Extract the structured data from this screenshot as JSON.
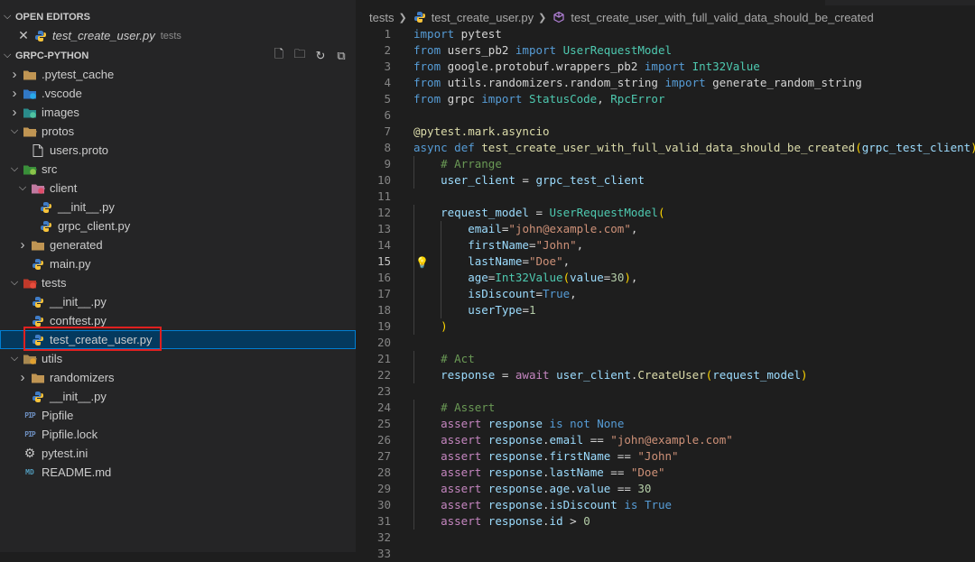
{
  "sidebar": {
    "open_editors_title": "OPEN EDITORS",
    "open_editor": {
      "name": "test_create_user.py",
      "folder": "tests"
    },
    "project_title": "GRPC-PYTHON",
    "tree": [
      {
        "label": ".pytest_cache",
        "icon": "folder-icon",
        "chevron": "closed",
        "level": 0
      },
      {
        "label": ".vscode",
        "icon": "vscode-folder-icon",
        "chevron": "closed",
        "level": 0
      },
      {
        "label": "images",
        "icon": "images-folder-icon",
        "chevron": "closed",
        "level": 0
      },
      {
        "label": "protos",
        "icon": "folder-open-icon",
        "chevron": "open",
        "level": 0
      },
      {
        "label": "users.proto",
        "icon": "file-icon",
        "chevron": "none",
        "level": 1
      },
      {
        "label": "src",
        "icon": "src-folder-icon",
        "chevron": "open",
        "level": 0
      },
      {
        "label": "client",
        "icon": "client-folder-icon",
        "chevron": "open",
        "level": 1
      },
      {
        "label": "__init__.py",
        "icon": "python-icon",
        "chevron": "none",
        "level": 2
      },
      {
        "label": "grpc_client.py",
        "icon": "python-icon",
        "chevron": "none",
        "level": 2
      },
      {
        "label": "generated",
        "icon": "folder-icon",
        "chevron": "closed",
        "level": 1
      },
      {
        "label": "main.py",
        "icon": "python-icon",
        "chevron": "none",
        "level": 1
      },
      {
        "label": "tests",
        "icon": "tests-folder-icon",
        "chevron": "open",
        "level": 0
      },
      {
        "label": "__init__.py",
        "icon": "python-icon",
        "chevron": "none",
        "level": 1
      },
      {
        "label": "conftest.py",
        "icon": "python-icon",
        "chevron": "none",
        "level": 1
      },
      {
        "label": "test_create_user.py",
        "icon": "python-icon",
        "chevron": "none",
        "level": 1,
        "selected": true
      },
      {
        "label": "utils",
        "icon": "utils-folder-icon",
        "chevron": "open",
        "level": 0
      },
      {
        "label": "randomizers",
        "icon": "folder-icon",
        "chevron": "closed",
        "level": 1
      },
      {
        "label": "__init__.py",
        "icon": "python-icon",
        "chevron": "none",
        "level": 1
      },
      {
        "label": "Pipfile",
        "icon": "pipfile-icon",
        "chevron": "none",
        "level": 0
      },
      {
        "label": "Pipfile.lock",
        "icon": "pipfile-icon",
        "chevron": "none",
        "level": 0
      },
      {
        "label": "pytest.ini",
        "icon": "gear-icon",
        "chevron": "none",
        "level": 0
      },
      {
        "label": "README.md",
        "icon": "readme-icon",
        "chevron": "none",
        "level": 0
      }
    ]
  },
  "breadcrumb": {
    "folder": "tests",
    "file": "test_create_user.py",
    "symbol": "test_create_user_with_full_valid_data_should_be_created"
  },
  "editor": {
    "active_line": 15,
    "lines": [
      {
        "n": "1",
        "text": "import pytest"
      },
      {
        "n": "2",
        "text": "from users_pb2 import UserRequestModel"
      },
      {
        "n": "3",
        "text": "from google.protobuf.wrappers_pb2 import Int32Value"
      },
      {
        "n": "4",
        "text": "from utils.randomizers.random_string import generate_random_string"
      },
      {
        "n": "5",
        "text": "from grpc import StatusCode, RpcError"
      },
      {
        "n": "6",
        "text": ""
      },
      {
        "n": "7",
        "text": "@pytest.mark.asyncio"
      },
      {
        "n": "8",
        "text": "async def test_create_user_with_full_valid_data_should_be_created(grpc_test_client):"
      },
      {
        "n": "9",
        "text": "    # Arrange"
      },
      {
        "n": "10",
        "text": "    user_client = grpc_test_client"
      },
      {
        "n": "11",
        "text": ""
      },
      {
        "n": "12",
        "text": "    request_model = UserRequestModel("
      },
      {
        "n": "13",
        "text": "        email=\"john@example.com\","
      },
      {
        "n": "14",
        "text": "        firstName=\"John\","
      },
      {
        "n": "15",
        "text": "        lastName=\"Doe\","
      },
      {
        "n": "16",
        "text": "        age=Int32Value(value=30),"
      },
      {
        "n": "17",
        "text": "        isDiscount=True,"
      },
      {
        "n": "18",
        "text": "        userType=1"
      },
      {
        "n": "19",
        "text": "    )"
      },
      {
        "n": "20",
        "text": ""
      },
      {
        "n": "21",
        "text": "    # Act"
      },
      {
        "n": "22",
        "text": "    response = await user_client.CreateUser(request_model)"
      },
      {
        "n": "23",
        "text": ""
      },
      {
        "n": "24",
        "text": "    # Assert"
      },
      {
        "n": "25",
        "text": "    assert response is not None"
      },
      {
        "n": "26",
        "text": "    assert response.email == \"john@example.com\""
      },
      {
        "n": "27",
        "text": "    assert response.firstName == \"John\""
      },
      {
        "n": "28",
        "text": "    assert response.lastName == \"Doe\""
      },
      {
        "n": "29",
        "text": "    assert response.age.value == 30"
      },
      {
        "n": "30",
        "text": "    assert response.isDiscount is True"
      },
      {
        "n": "31",
        "text": "    assert response.id > 0"
      },
      {
        "n": "32",
        "text": ""
      },
      {
        "n": "33",
        "text": ""
      }
    ]
  },
  "colors": {
    "sidebar_bg": "#252526",
    "editor_bg": "#1e1e1e",
    "selection": "#04395e",
    "highlight_box": "#e0201f"
  }
}
